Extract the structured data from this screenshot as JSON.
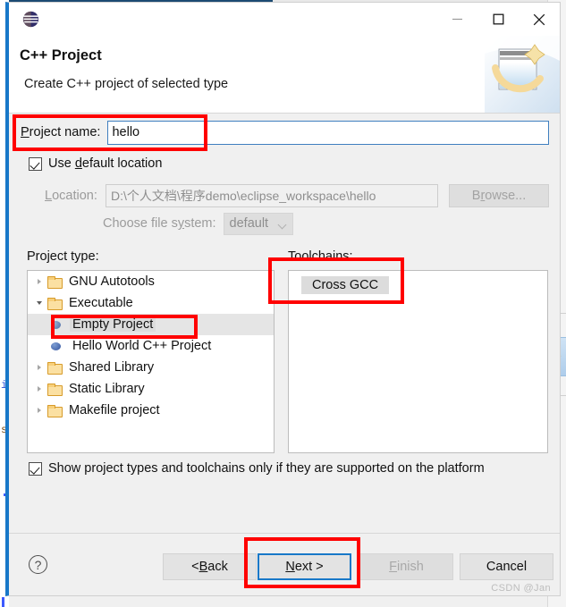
{
  "window": {
    "app_icon": "eclipse-logo-icon",
    "minimize_label": "–",
    "maximize_label": "□",
    "close_label": "✕"
  },
  "header": {
    "title": "C++ Project",
    "subtitle": "Create C++ project of selected type",
    "banner_icon": "new-project-banner-icon"
  },
  "form": {
    "project_name_label": "Project name:",
    "project_name_value": "hello",
    "use_default_location_label": "Use default location",
    "use_default_location_checked": true,
    "location_label": "Location:",
    "location_value": "D:\\个人文档\\程序demo\\eclipse_workspace\\hello",
    "browse_label": "Browse...",
    "choose_file_system_label": "Choose file system:",
    "file_system_value": "default"
  },
  "project_type": {
    "label": "Project type:",
    "items": [
      {
        "label": "GNU Autotools",
        "icon": "folder-icon",
        "twisty": "collapsed",
        "level": 0,
        "selected": false
      },
      {
        "label": "Executable",
        "icon": "folder-icon",
        "twisty": "expanded",
        "level": 0,
        "selected": false
      },
      {
        "label": "Empty Project",
        "icon": "bullet-icon",
        "twisty": "none",
        "level": 1,
        "selected": true
      },
      {
        "label": "Hello World C++ Project",
        "icon": "bullet-icon",
        "twisty": "none",
        "level": 1,
        "selected": false
      },
      {
        "label": "Shared Library",
        "icon": "folder-icon",
        "twisty": "collapsed",
        "level": 0,
        "selected": false
      },
      {
        "label": "Static Library",
        "icon": "folder-icon",
        "twisty": "collapsed",
        "level": 0,
        "selected": false
      },
      {
        "label": "Makefile project",
        "icon": "folder-icon",
        "twisty": "collapsed",
        "level": 0,
        "selected": false
      }
    ]
  },
  "toolchains": {
    "label": "Toolchains:",
    "items": [
      {
        "label": "Cross GCC",
        "selected": true
      }
    ]
  },
  "platform_filter": {
    "label": "Show project types and toolchains only if they are supported on the platform",
    "checked": true
  },
  "footer": {
    "help_label": "?",
    "back_label": "< Back",
    "next_label": "Next >",
    "finish_label": "Finish",
    "cancel_label": "Cancel",
    "watermark": "CSDN @Jan"
  },
  "annotations": {
    "colors": {
      "highlight": "#ff0000",
      "accent": "#1878c8"
    },
    "boxes": [
      {
        "name": "project-name-row"
      },
      {
        "name": "toolchains-cross-gcc"
      },
      {
        "name": "empty-project-item"
      },
      {
        "name": "next-button"
      }
    ]
  },
  "background": {
    "code_marker_i": "i",
    "code_marker_s": "s"
  }
}
